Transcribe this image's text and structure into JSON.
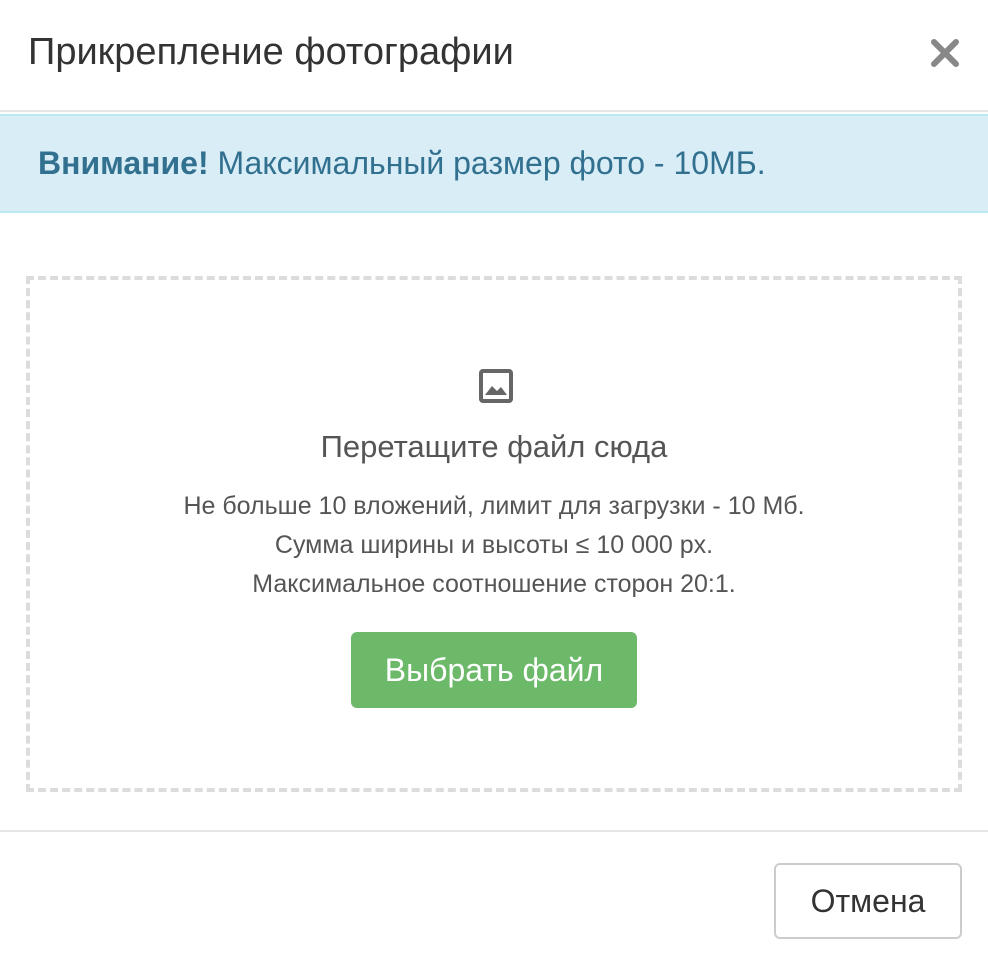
{
  "dialog": {
    "title": "Прикрепление фотографии",
    "close_icon": "close-icon"
  },
  "alert": {
    "strong": "Внимание!",
    "message": " Максимальный размер фото - 10МБ."
  },
  "dropzone": {
    "icon": "image-icon",
    "title": "Перетащите файл сюда",
    "hints": [
      "Не больше 10 вложений, лимит для загрузки - 10 Мб.",
      "Сумма ширины и высоты ≤ 10 000 px.",
      "Максимальное соотношение сторон 20:1."
    ],
    "choose_button": "Выбрать файл"
  },
  "footer": {
    "cancel_button": "Отмена"
  },
  "colors": {
    "alert_bg": "#d9edf7",
    "alert_text": "#31708f",
    "primary_button": "#6cb96a",
    "close_icon": "#888888",
    "dropzone_border": "#dcdcdc"
  }
}
